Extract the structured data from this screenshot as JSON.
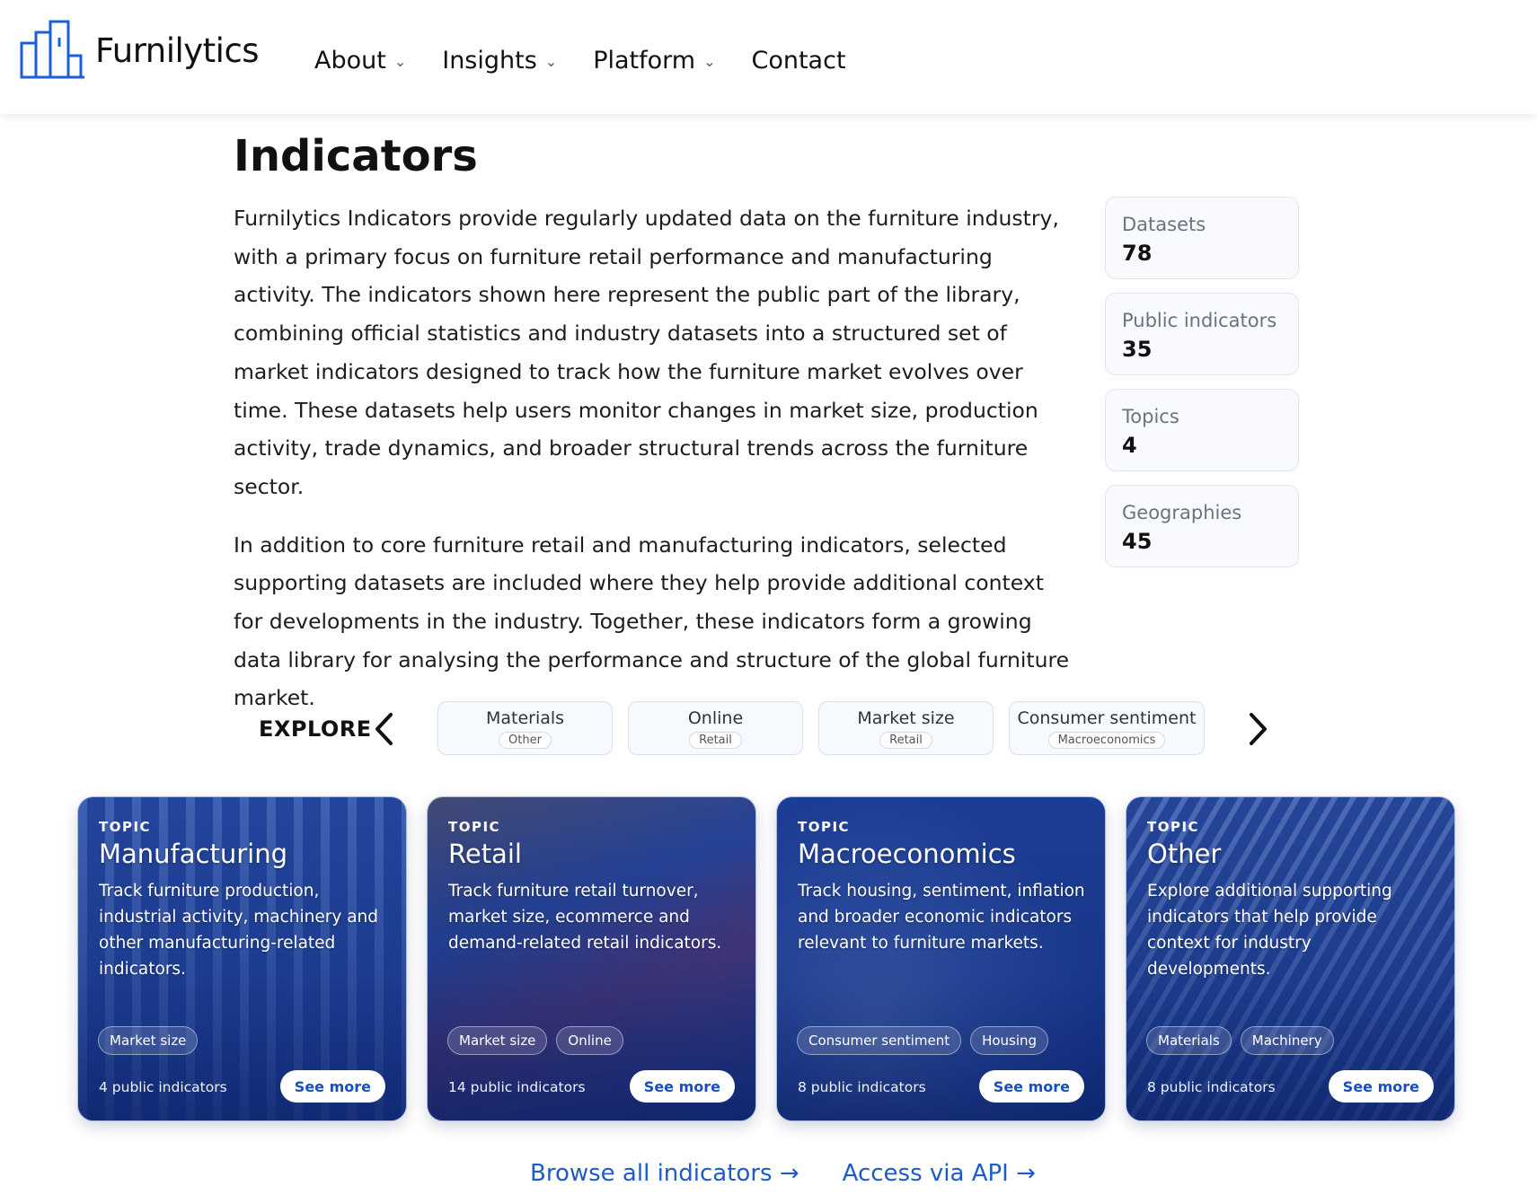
{
  "header": {
    "brand": "Furnilytics",
    "nav": [
      {
        "label": "About",
        "has_dropdown": true
      },
      {
        "label": "Insights",
        "has_dropdown": true
      },
      {
        "label": "Platform",
        "has_dropdown": true
      },
      {
        "label": "Contact",
        "has_dropdown": false
      }
    ],
    "icons": {
      "logo": "bar-chart-logo-icon",
      "dropdown": "chevron-down-icon"
    }
  },
  "main": {
    "title": "Indicators",
    "paragraphs": [
      "Furnilytics Indicators provide regularly updated data on the furniture industry, with a primary focus on furniture retail performance and manufacturing activity. The indicators shown here represent the public part of the library, combining official statistics and industry datasets into a structured set of market indicators designed to track how the furniture market evolves over time. These datasets help users monitor changes in market size, production activity, trade dynamics, and broader structural trends across the furniture sector.",
      "In addition to core furniture retail and manufacturing indicators, selected supporting datasets are included where they help provide additional context for developments in the industry. Together, these indicators form a growing data library for analysing the performance and structure of the global furniture market."
    ],
    "stats": [
      {
        "label": "Datasets",
        "value": "78"
      },
      {
        "label": "Public indicators",
        "value": "35"
      },
      {
        "label": "Topics",
        "value": "4"
      },
      {
        "label": "Geographies",
        "value": "45"
      }
    ]
  },
  "explore": {
    "label": "EXPLORE",
    "icons": {
      "prev": "chevron-left-icon",
      "next": "chevron-right-icon"
    },
    "chips": [
      {
        "title": "Materials",
        "sub": "Other"
      },
      {
        "title": "Online",
        "sub": "Retail"
      },
      {
        "title": "Market size",
        "sub": "Retail"
      },
      {
        "title": "Consumer sentiment",
        "sub": "Macroeconomics"
      }
    ]
  },
  "cards": [
    {
      "tag": "TOPIC",
      "title": "Manufacturing",
      "desc": "Track furniture production, industrial activity, machinery and other manufacturing-related indicators.",
      "tags": [
        "Market size"
      ],
      "count": "4 public indicators",
      "button": "See more"
    },
    {
      "tag": "TOPIC",
      "title": "Retail",
      "desc": "Track furniture retail turnover, market size, ecommerce and demand-related retail indicators.",
      "tags": [
        "Market size",
        "Online"
      ],
      "count": "14 public indicators",
      "button": "See more"
    },
    {
      "tag": "TOPIC",
      "title": "Macroeconomics",
      "desc": "Track housing, sentiment, inflation and broader economic indicators relevant to furniture markets.",
      "tags": [
        "Consumer sentiment",
        "Housing"
      ],
      "count": "8 public indicators",
      "button": "See more"
    },
    {
      "tag": "TOPIC",
      "title": "Other",
      "desc": "Explore additional supporting indicators that help provide context for industry developments.",
      "tags": [
        "Materials",
        "Machinery"
      ],
      "count": "8 public indicators",
      "button": "See more"
    }
  ],
  "links": {
    "browse": "Browse all indicators →",
    "api": "Access via API →"
  },
  "colors": {
    "accent": "#1d5bc8",
    "card_overlay": "#183ca0"
  }
}
